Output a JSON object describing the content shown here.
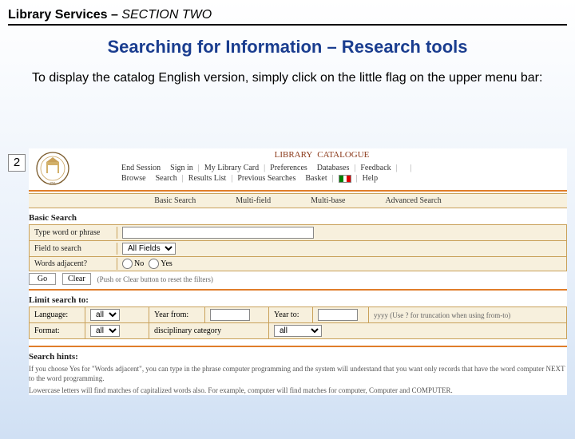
{
  "header": {
    "left": "Library Services – ",
    "right": "SECTION TWO"
  },
  "title": "Searching for Information – Research tools",
  "intro": "To display the catalog English version, simply click on the little flag on the upper menu bar:",
  "slide_number": "2",
  "catalog": {
    "library_label": "LIBRARY",
    "catalogue_label": "CATALOGUE",
    "menu_row1": [
      "End Session",
      "Sign in",
      "My Library Card",
      "Preferences",
      "Databases",
      "Feedback",
      ""
    ],
    "menu_row2": [
      "Browse",
      "Search",
      "Results List",
      "Previous Searches",
      "Basket",
      "",
      "Help"
    ],
    "search_types": [
      "Basic Search",
      "Multi-field",
      "Multi-base",
      "Advanced Search"
    ]
  },
  "basic_search": {
    "title": "Basic Search",
    "row_word": "Type word or phrase",
    "row_field": "Field to search",
    "field_value": "All Fields",
    "row_adj": "Words adjacent?",
    "adj_no": "No",
    "adj_yes": "Yes",
    "btn_go": "Go",
    "btn_clear": "Clear",
    "btn_tip": "(Push or Clear button to reset the filters)"
  },
  "limit": {
    "title": "Limit search to:",
    "language": "Language:",
    "language_value": "all",
    "year_from": "Year from:",
    "year_to": "Year to:",
    "year_tip": "yyyy (Use ? for truncation when using from-to)",
    "format": "Format:",
    "format_value": "all",
    "disc": "disciplinary category",
    "disc_value": "all"
  },
  "hints": {
    "title": "Search hints:",
    "p1": "If you choose Yes for \"Words adjacent\", you can type in the phrase computer programming and the system will understand that you want only records that have the word computer NEXT to the word programming.",
    "p2": "Lowercase letters will find matches of capitalized words also. For example, computer will find matches for computer, Computer and COMPUTER."
  }
}
